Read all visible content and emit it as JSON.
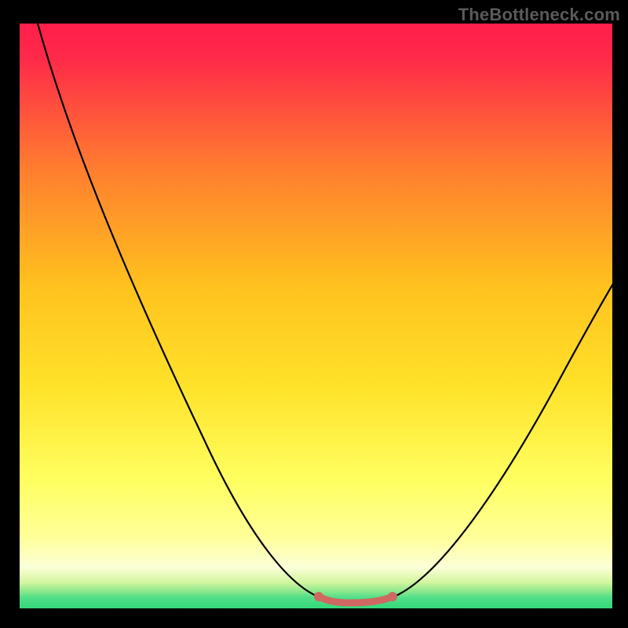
{
  "watermark": "TheBottleneck.com",
  "colors": {
    "gradient_top": "#ff1e4b",
    "gradient_mid1": "#ff8a2a",
    "gradient_mid2": "#ffd726",
    "gradient_mid3": "#ffff60",
    "gradient_bottom_yellow": "#ffffb0",
    "gradient_bottom_green": "#34e27a",
    "curve": "#000000",
    "valley_marker": "#cf6860",
    "frame": "#000000"
  },
  "chart_data": {
    "type": "line",
    "title": "",
    "xlabel": "",
    "ylabel": "",
    "x_range": [
      0,
      100
    ],
    "y_range": [
      0,
      100
    ],
    "series": [
      {
        "name": "curve",
        "x": [
          3,
          7,
          12,
          18,
          24,
          30,
          36,
          42,
          48,
          51,
          54,
          58,
          62,
          66,
          72,
          78,
          85,
          92,
          100
        ],
        "values": [
          98,
          90,
          80,
          68,
          56,
          44,
          32,
          20,
          8,
          3,
          1,
          1,
          1,
          3,
          10,
          22,
          36,
          48,
          60
        ]
      }
    ],
    "minimum_plateau": {
      "x_start": 51,
      "x_end": 63,
      "value": 1
    },
    "annotations": []
  }
}
